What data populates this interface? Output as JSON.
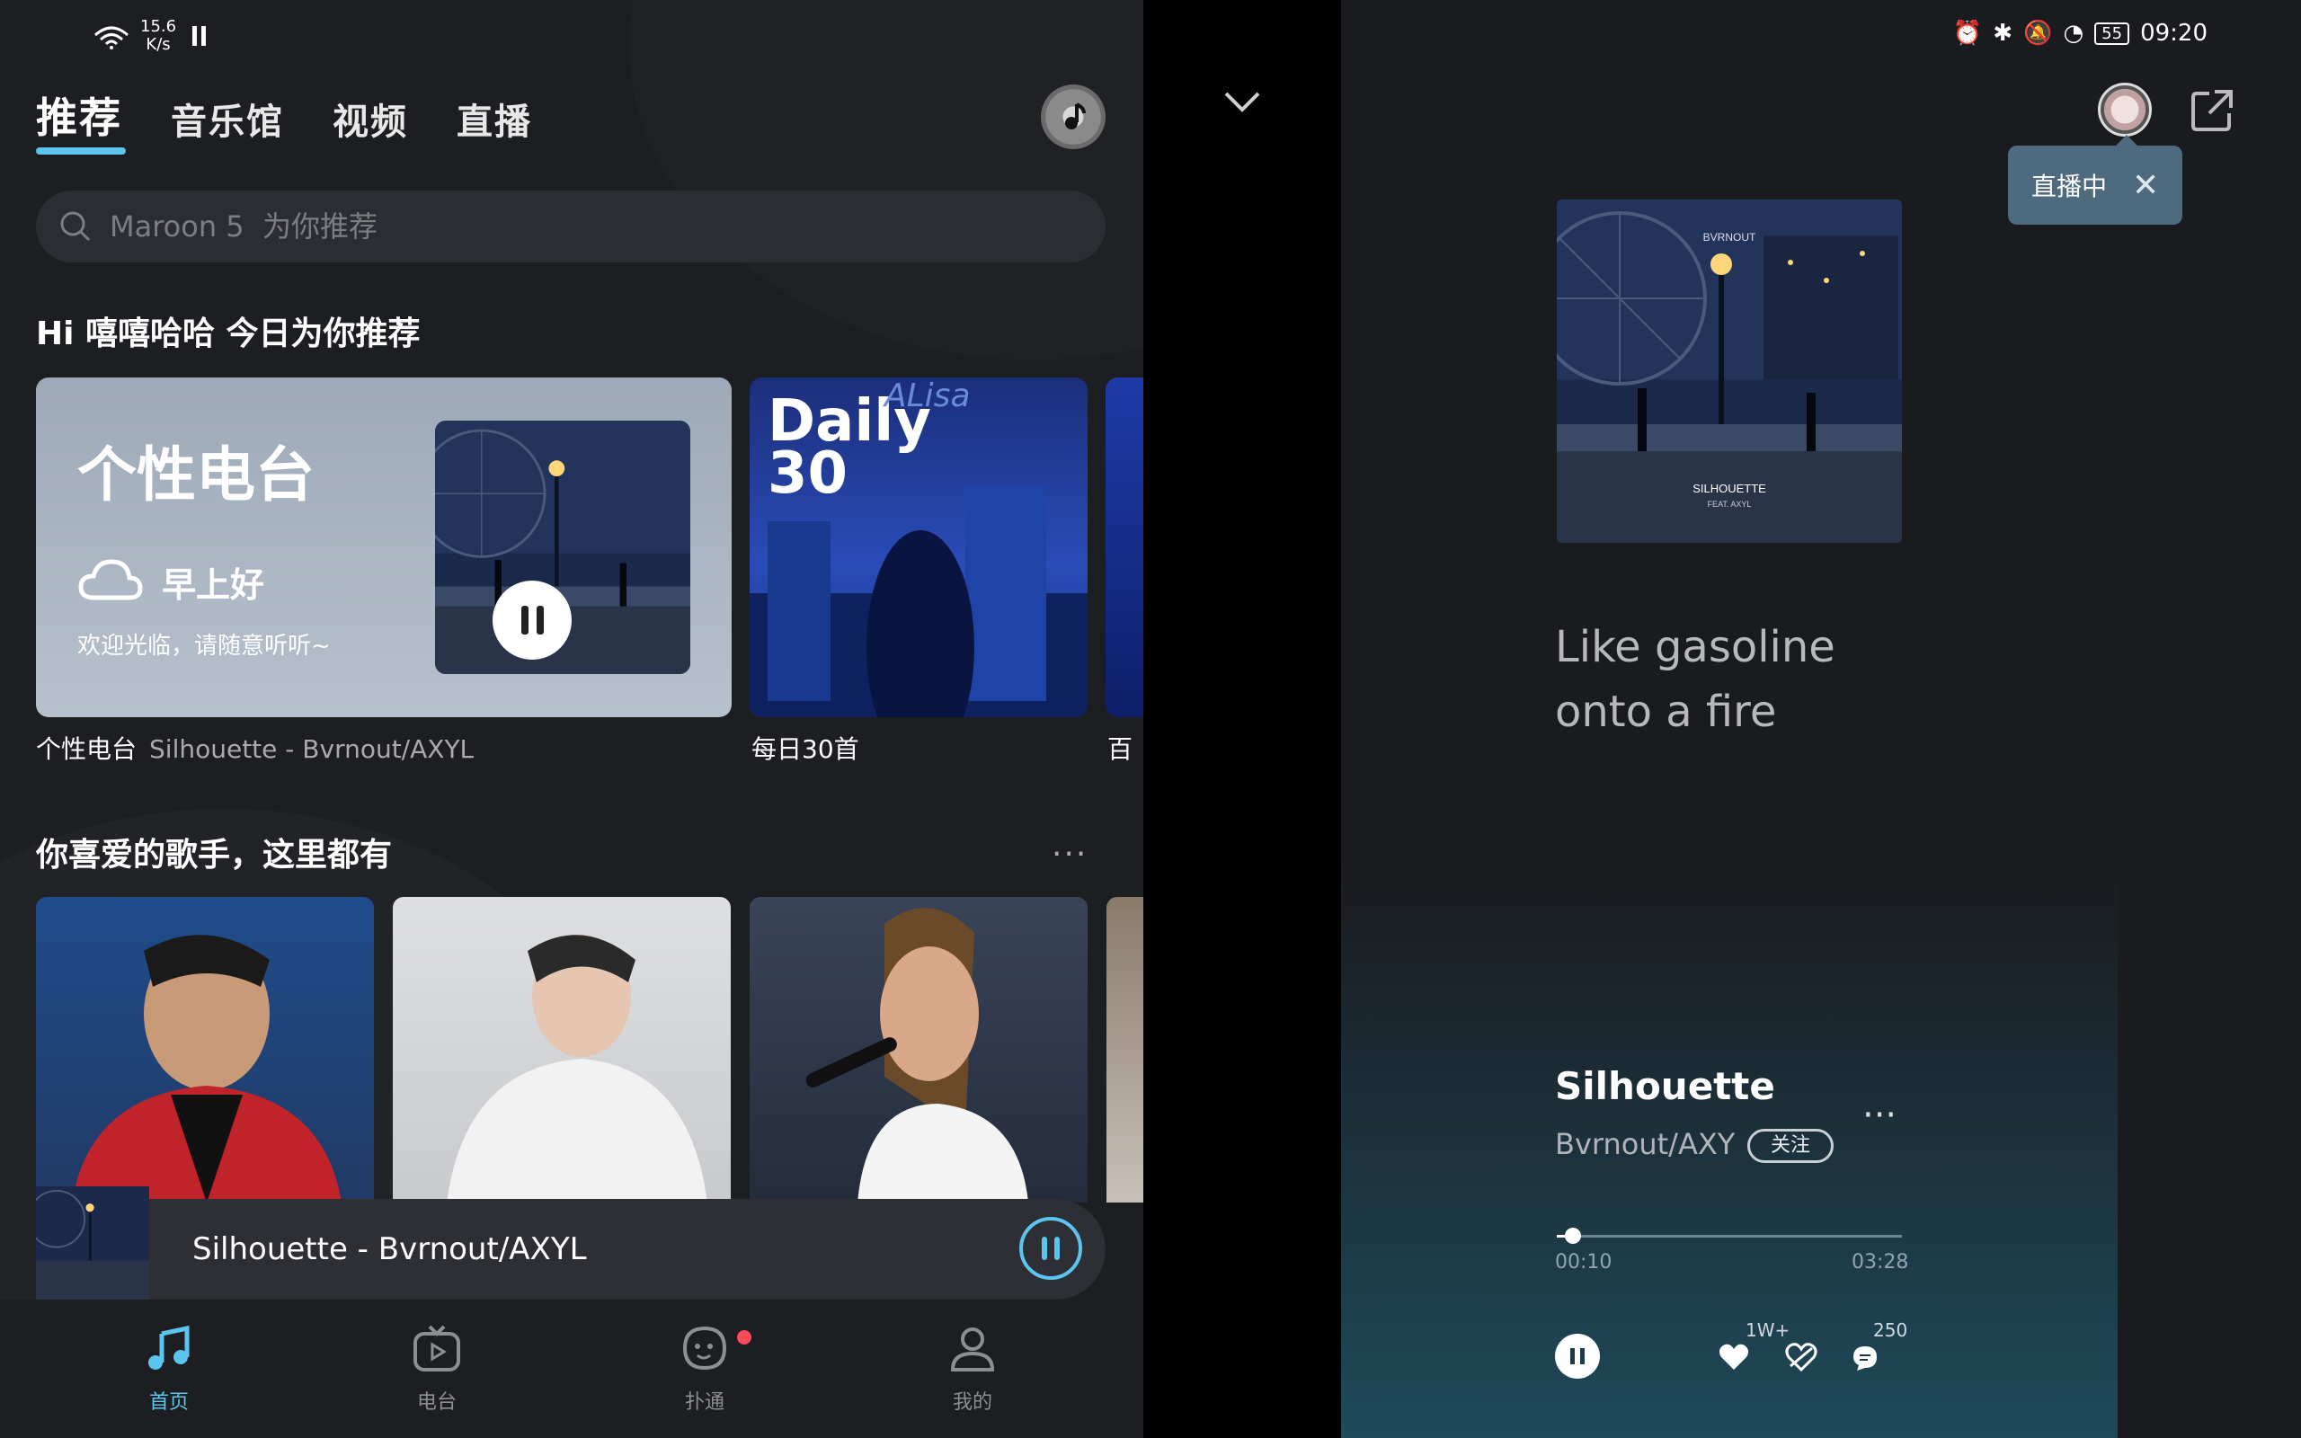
{
  "status_left": {
    "speed_value": "15.6",
    "speed_unit": "K/s"
  },
  "status_right": {
    "battery": "55",
    "time": "09:20"
  },
  "tabs": [
    {
      "label": "推荐",
      "active": true
    },
    {
      "label": "音乐馆",
      "active": false
    },
    {
      "label": "视频",
      "active": false
    },
    {
      "label": "直播",
      "active": false
    }
  ],
  "search": {
    "placeholder": "Maroon 5  为你推荐"
  },
  "greeting": "Hi 嘻嘻哈哈  今日为你推荐",
  "radio_card": {
    "title": "个性电台",
    "greeting": "早上好",
    "welcome": "欢迎光临，请随意听听~",
    "caption": "个性电台",
    "caption_sub": "Silhouette - Bvrnout/AXYL"
  },
  "daily_card": {
    "title_line1": "Daily",
    "title_line2": "30",
    "watermark": "ALisa",
    "caption": "每日30首"
  },
  "third_card": {
    "caption": "百"
  },
  "artists_section": {
    "title": "你喜爱的歌手，这里都有",
    "more": "···"
  },
  "mini_player": {
    "title": "Silhouette - Bvrnout/AXYL"
  },
  "nav": [
    {
      "label": "首页",
      "icon": "music-note-icon",
      "active": true
    },
    {
      "label": "电台",
      "icon": "tv-icon",
      "active": false
    },
    {
      "label": "扑通",
      "icon": "face-icon",
      "active": false
    },
    {
      "label": "我的",
      "icon": "person-icon",
      "active": false
    }
  ],
  "cover_art": {
    "brand": "BVRNOUT",
    "title": "SILHOUETTE",
    "feat": "FEAT. AXYL"
  },
  "right": {
    "tooltip": "直播中",
    "lyric_line1": "Like gasoline",
    "lyric_line2": "onto a fire",
    "song_title": "Silhouette",
    "song_artist": "Bvrnout/AXYL",
    "follow": "关注",
    "elapsed": "00:10",
    "duration": "03:28",
    "progress": 0.048,
    "likes": "1W+",
    "comments": "250"
  },
  "colors": {
    "accent": "#5bc4ef",
    "notification": "#ff4a5a",
    "tooltip_bg": "#4d6a7e"
  }
}
